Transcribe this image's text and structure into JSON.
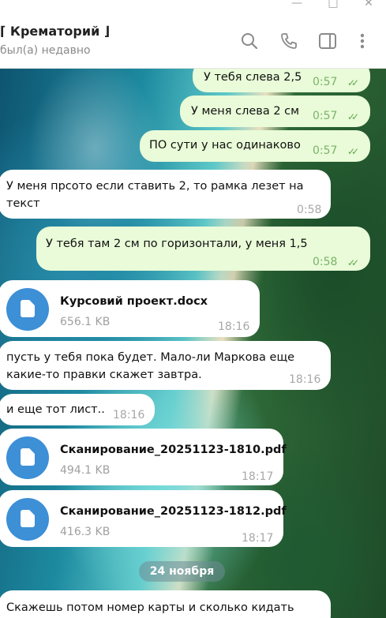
{
  "chat": {
    "title": "⌈ Крематорий ⌋",
    "status": "был(а) недавно"
  },
  "messages": [
    {
      "dir": "out",
      "text": "У тебя слева 2,5",
      "time": "0:57"
    },
    {
      "dir": "out",
      "text": "У меня слева 2 см",
      "time": "0:57"
    },
    {
      "dir": "out",
      "text": "ПО сути у нас одинаково",
      "time": "0:57"
    },
    {
      "dir": "in",
      "text_line1": "У меня прсото если ставить 2, то рамка лезет на",
      "text_line2": "текст",
      "time": "0:58"
    },
    {
      "dir": "out",
      "text": "У тебя там 2 см по горизонтали, у меня 1,5",
      "time": "0:58"
    },
    {
      "dir": "in",
      "file_name": "Курсовий проект.docx",
      "file_size": "656.1 KB",
      "time": "18:16"
    },
    {
      "dir": "in",
      "text_line1": "пусть у тебя пока будет. Мало-ли Маркова еще",
      "text_line2": "какие-то правки скажет завтра.",
      "time": "18:16"
    },
    {
      "dir": "in",
      "text": "и еще тот лист..",
      "time": "18:16"
    },
    {
      "dir": "in",
      "file_name": "Сканирование_20251123-1810.pdf",
      "file_size": "494.1 KB",
      "time": "18:17"
    },
    {
      "dir": "in",
      "file_name": "Сканирование_20251123-1812.pdf",
      "file_size": "416.3 KB",
      "time": "18:17"
    },
    {
      "dir": "in",
      "text": "Скажешь потом номер карты и сколько кидать"
    }
  ],
  "date_separator": "24 ноября",
  "icons": {
    "minimize": "minimize-icon",
    "maximize": "maximize-icon",
    "close": "close-icon",
    "search": "search-icon",
    "call": "phone-icon",
    "sidebar": "sidebar-toggle-icon",
    "more": "more-vertical-icon",
    "file": "document-icon",
    "read": "double-check-icon"
  },
  "colors": {
    "outgoing_bubble": "#e9fbd8",
    "incoming_bubble": "#ffffff",
    "file_icon": "#3d8fd6",
    "read_check": "#5fa84a"
  }
}
